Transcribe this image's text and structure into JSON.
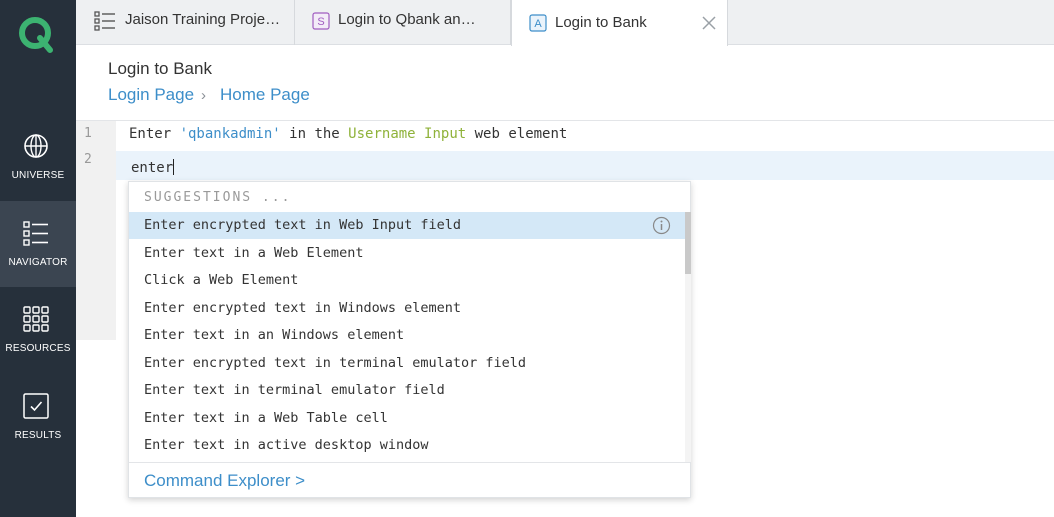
{
  "nav": {
    "items": [
      {
        "label": "UNIVERSE",
        "icon": "globe-icon"
      },
      {
        "label": "NAVIGATOR",
        "icon": "list-icon"
      },
      {
        "label": "RESOURCES",
        "icon": "grid-icon"
      },
      {
        "label": "RESULTS",
        "icon": "checkbox-icon"
      }
    ]
  },
  "tabs": [
    {
      "label": "Jaison Training Proje…",
      "icon": "list-icon"
    },
    {
      "label": "Login to Qbank an…",
      "icon": "S",
      "icon_color": "#a05cc0"
    },
    {
      "label": "Login to Bank",
      "icon": "A",
      "icon_color": "#3d8ec9"
    }
  ],
  "header": {
    "title": "Login to Bank",
    "breadcrumb": [
      "Login Page",
      "Home Page"
    ],
    "breadcrumb_separator": "›"
  },
  "editor": {
    "line_numbers": [
      "1",
      "2"
    ],
    "line1": {
      "kw1": "Enter ",
      "str": "'qbankadmin'",
      "kw2": " in the ",
      "obj": "Username Input",
      "kw3": " web element"
    },
    "line2": "enter"
  },
  "suggestions": {
    "header": "SUGGESTIONS ...",
    "items": [
      "Enter encrypted text in Web Input field",
      "Enter text in a Web Element",
      "Click a Web Element",
      "Enter encrypted text in Windows element",
      "Enter text in an Windows element",
      "Enter encrypted text in terminal emulator field",
      "Enter text in terminal emulator field",
      "Enter text in a Web Table cell",
      "Enter text in active desktop window"
    ],
    "selected_index": 0,
    "footer_link": "Command Explorer >"
  },
  "colors": {
    "sidebar": "#26303b",
    "accent": "#3d8ec9",
    "object": "#8fb23a",
    "logo": "#3cb371"
  }
}
